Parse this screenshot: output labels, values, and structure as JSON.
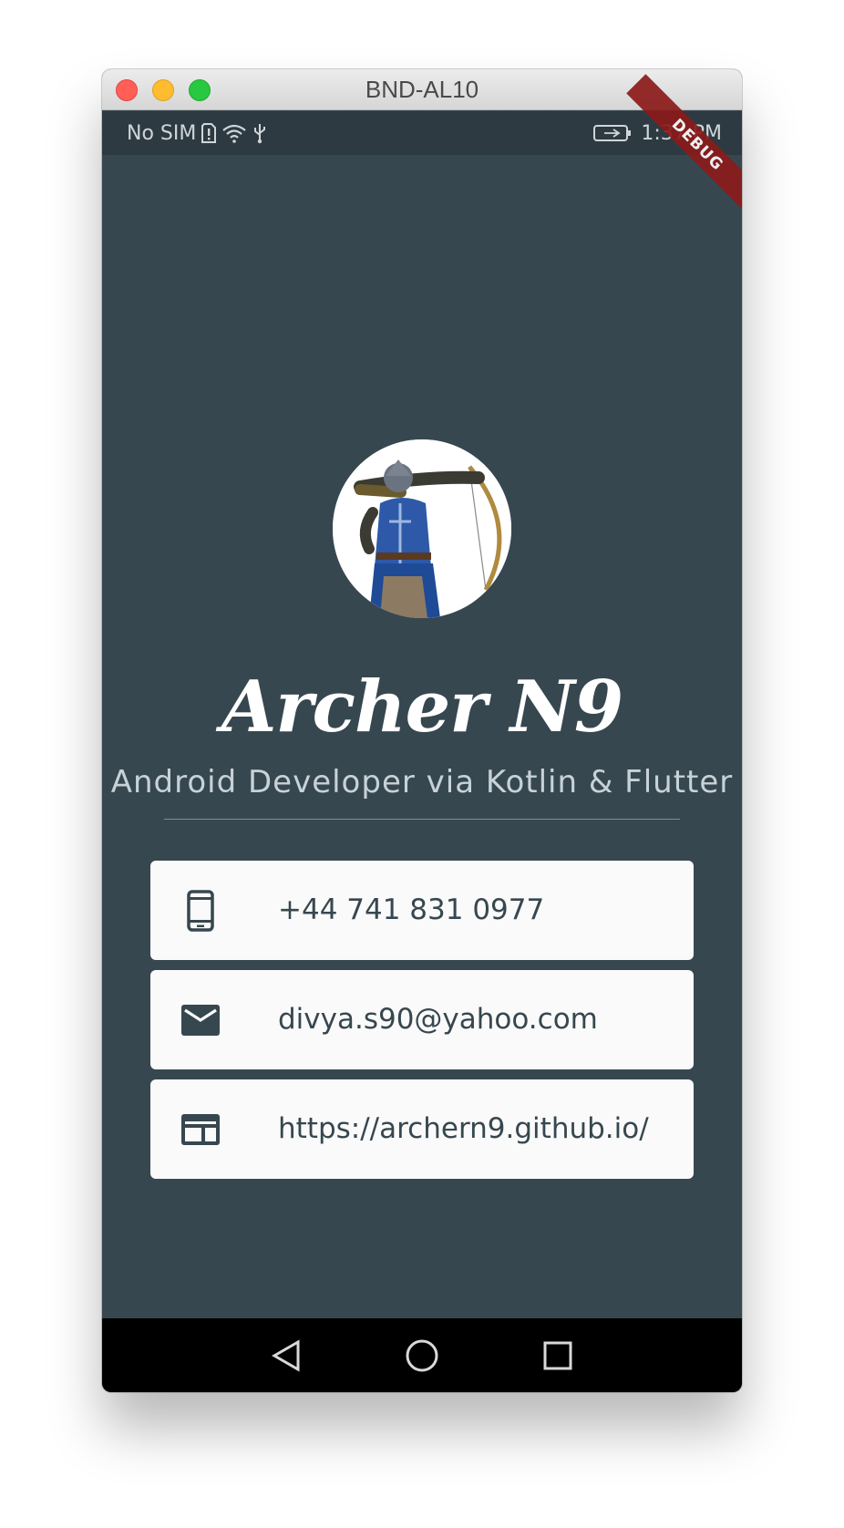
{
  "window": {
    "title": "BND-AL10"
  },
  "status_bar": {
    "carrier": "No SIM",
    "time": "1:37 PM"
  },
  "debug_banner": {
    "label": "DEBUG"
  },
  "profile": {
    "name": "Archer N9",
    "subtitle": "Android Developer via Kotlin & Flutter"
  },
  "contacts": [
    {
      "icon": "phone-icon",
      "text": "+44 741 831 0977"
    },
    {
      "icon": "email-icon",
      "text": "divya.s90@yahoo.com"
    },
    {
      "icon": "web-icon",
      "text": "https://archern9.github.io/"
    }
  ],
  "colors": {
    "background": "#37474f",
    "card": "#fafafa",
    "status_bar": "#2d3a41",
    "debug_ribbon": "#8b1b1b"
  }
}
